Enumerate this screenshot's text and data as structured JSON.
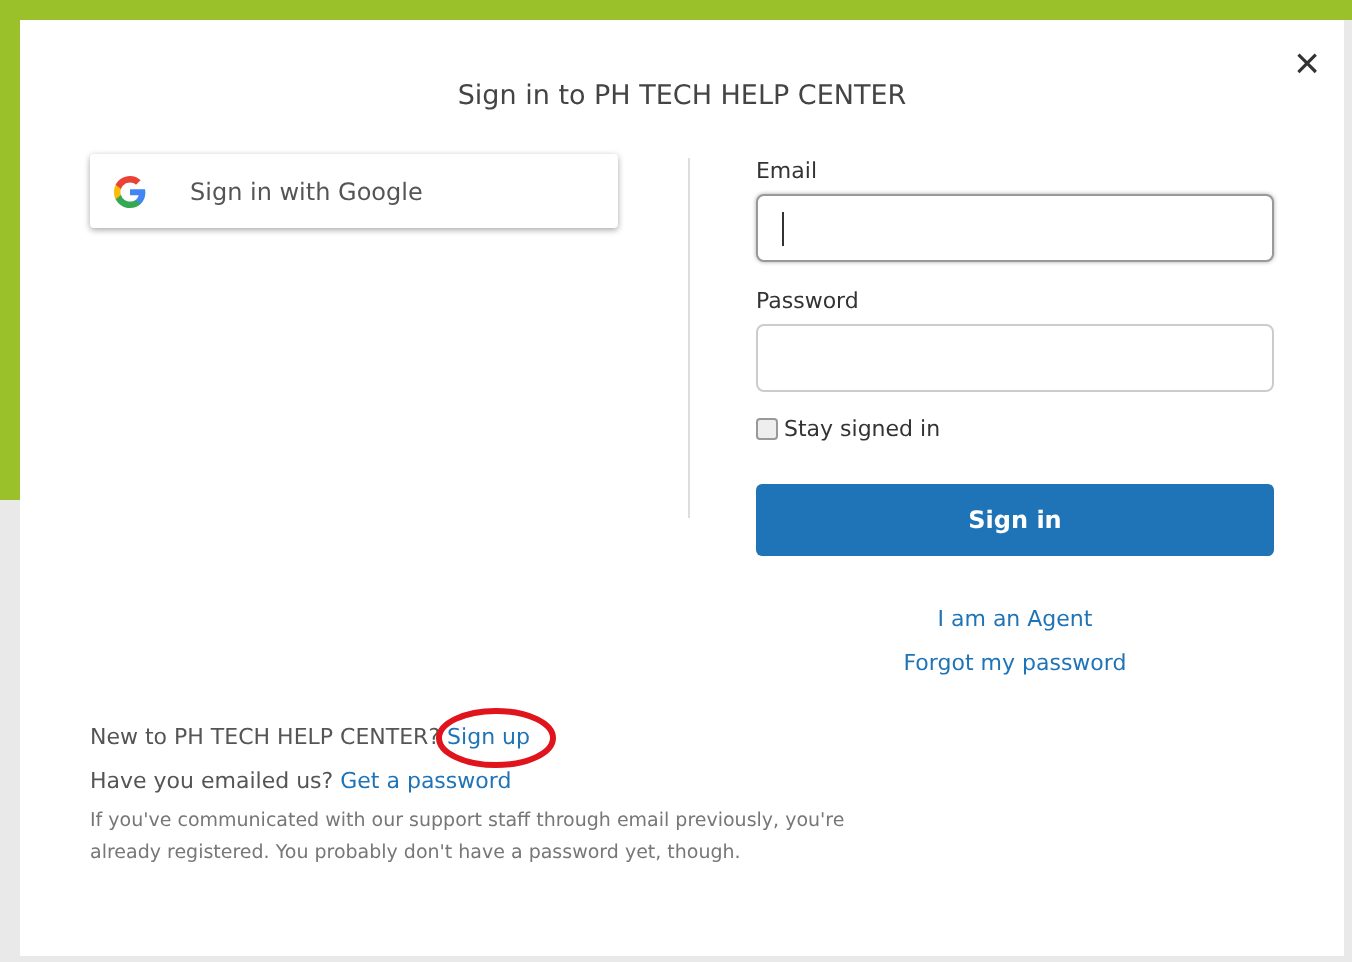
{
  "dialog": {
    "title": "Sign in to PH TECH HELP CENTER",
    "close": "×"
  },
  "google_button": {
    "label": "Sign in with Google"
  },
  "form": {
    "fields": [
      {
        "label": "Email",
        "focused": true
      },
      {
        "label": "Password",
        "focused": false
      }
    ],
    "stay_signed_in": {
      "label": "Stay signed in",
      "checked": false
    },
    "submit": "Sign in",
    "links": [
      "I am an Agent",
      "Forgot my password"
    ]
  },
  "footer": {
    "signup_prompt": "New to PH TECH HELP CENTER?",
    "signup_link": "Sign up",
    "signup_circled": true,
    "emailed_prompt": "Have you emailed us?",
    "password_link": "Get a password",
    "note": "If you've communicated with our support staff through email previously, you're already registered. You probably don't have a password yet, though."
  }
}
